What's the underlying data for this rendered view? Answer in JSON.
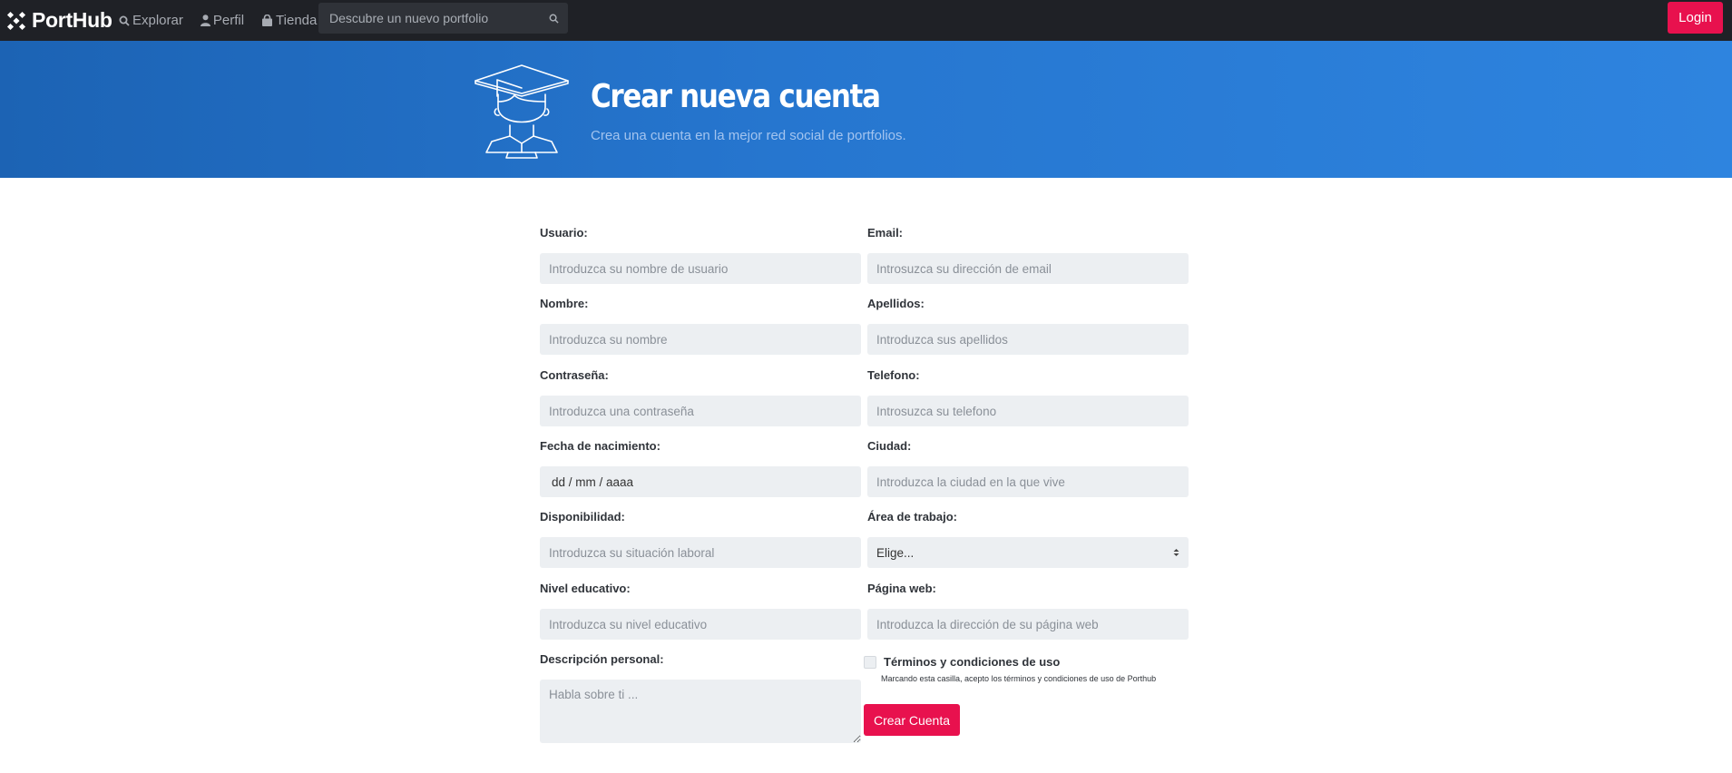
{
  "nav": {
    "brand": "PortHub",
    "links": [
      "Explorar",
      "Perfil",
      "Tienda"
    ],
    "search_placeholder": "Descubre un nuevo portfolio",
    "login_label": "Login"
  },
  "hero": {
    "title": "Crear nueva cuenta",
    "subtitle": "Crea una cuenta en la mejor red social de portfolios."
  },
  "form": {
    "usuario": {
      "label": "Usuario:",
      "placeholder": "Introduzca su nombre de usuario"
    },
    "email": {
      "label": "Email:",
      "placeholder": "Introsuzca su dirección de email"
    },
    "nombre": {
      "label": "Nombre:",
      "placeholder": "Introduzca su nombre"
    },
    "apellidos": {
      "label": "Apellidos:",
      "placeholder": "Introduzca sus apellidos"
    },
    "contrasena": {
      "label": "Contraseña:",
      "placeholder": "Introduzca una contraseña"
    },
    "telefono": {
      "label": "Telefono:",
      "placeholder": "Introsuzca su telefono"
    },
    "fecha": {
      "label": "Fecha de nacimiento:",
      "value": "dd / mm / aaaa"
    },
    "ciudad": {
      "label": "Ciudad:",
      "placeholder": "Introduzca la ciudad en la que vive"
    },
    "disponibilidad": {
      "label": "Disponibilidad:",
      "placeholder": "Introduzca su situación laboral"
    },
    "area": {
      "label": "Área de trabajo:",
      "selected": "Elige..."
    },
    "nivel": {
      "label": "Nivel educativo:",
      "placeholder": "Introduzca su nivel educativo"
    },
    "web": {
      "label": "Página web:",
      "placeholder": "Introduzca la dirección de su página web"
    },
    "descripcion": {
      "label": "Descripción personal:",
      "placeholder": "Habla sobre ti ..."
    },
    "terms": {
      "title": "Términos y condiciones de uso",
      "help": "Marcando esta casilla, acepto los términos y condiciones de uso de Porthub"
    },
    "submit_label": "Crear Cuenta"
  },
  "colors": {
    "navbar": "#1f2126",
    "accent": "#e8114e",
    "hero_start": "#1c63b4",
    "hero_end": "#2e84df",
    "input_bg": "#eceff2"
  }
}
